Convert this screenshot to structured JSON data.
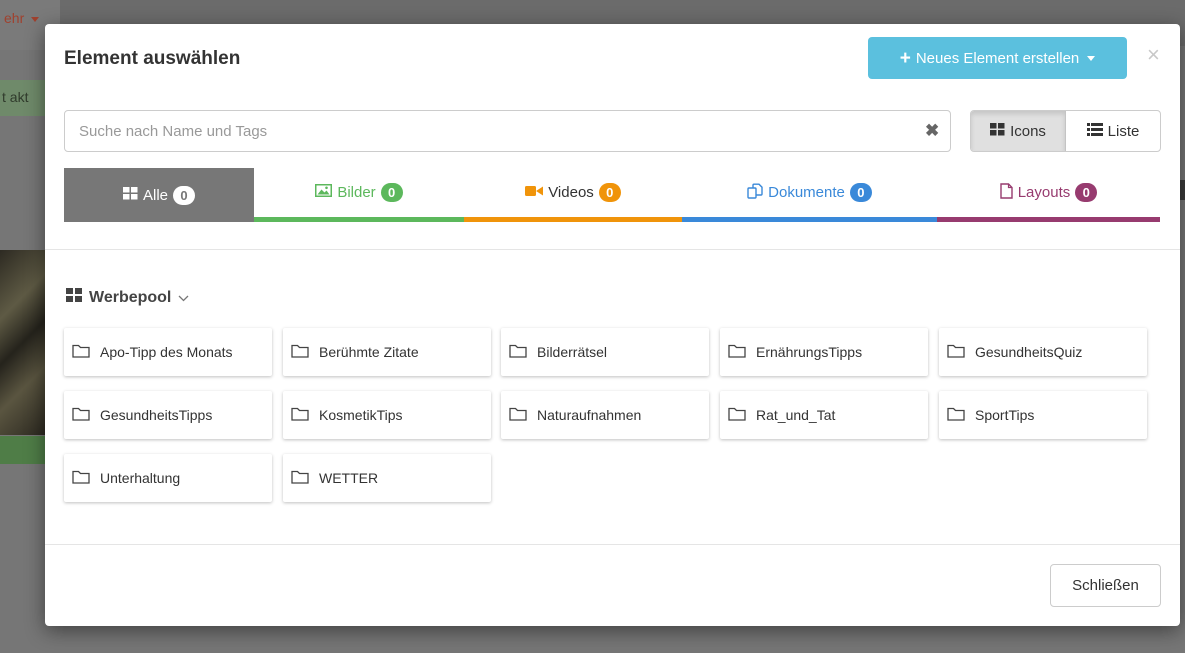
{
  "background": {
    "menu_text": "ehr",
    "status_text": "t akt"
  },
  "modal": {
    "title": "Element auswählen",
    "new_button_label": "Neues Element erstellen",
    "close_glyph": "×",
    "search": {
      "placeholder": "Suche nach Name und Tags",
      "value": "",
      "clear_glyph": "✖"
    },
    "view_toggle": {
      "icons_label": "Icons",
      "list_label": "Liste",
      "active": "Icons"
    },
    "tabs": [
      {
        "label": "Alle",
        "count": "0",
        "color": "#777777",
        "badge_color": "#ffffff",
        "active": true,
        "icon": "th-large-icon"
      },
      {
        "label": "Bilder",
        "count": "0",
        "color": "#5cb85c",
        "badge_color": "#5cb85c",
        "active": false,
        "icon": "image-icon"
      },
      {
        "label": "Videos",
        "count": "0",
        "color": "#f0940a",
        "badge_color": "#f0940a",
        "active": false,
        "icon": "video-icon"
      },
      {
        "label": "Dokumente",
        "count": "0",
        "color": "#3a89d9",
        "badge_color": "#3a89d9",
        "active": false,
        "icon": "documents-icon"
      },
      {
        "label": "Layouts",
        "count": "0",
        "color": "#973b6f",
        "badge_color": "#973b6f",
        "active": false,
        "icon": "file-icon"
      }
    ],
    "pool": {
      "label": "Werbepool"
    },
    "folders": [
      "Apo-Tipp des Monats",
      "Berühmte Zitate",
      "Bilderrätsel",
      "ErnährungsTipps",
      "GesundheitsQuiz",
      "GesundheitsTipps",
      "KosmetikTips",
      "Naturaufnahmen",
      "Rat_und_Tat",
      "SportTips",
      "Unterhaltung",
      "WETTER"
    ],
    "footer": {
      "close_label": "Schließen"
    }
  }
}
